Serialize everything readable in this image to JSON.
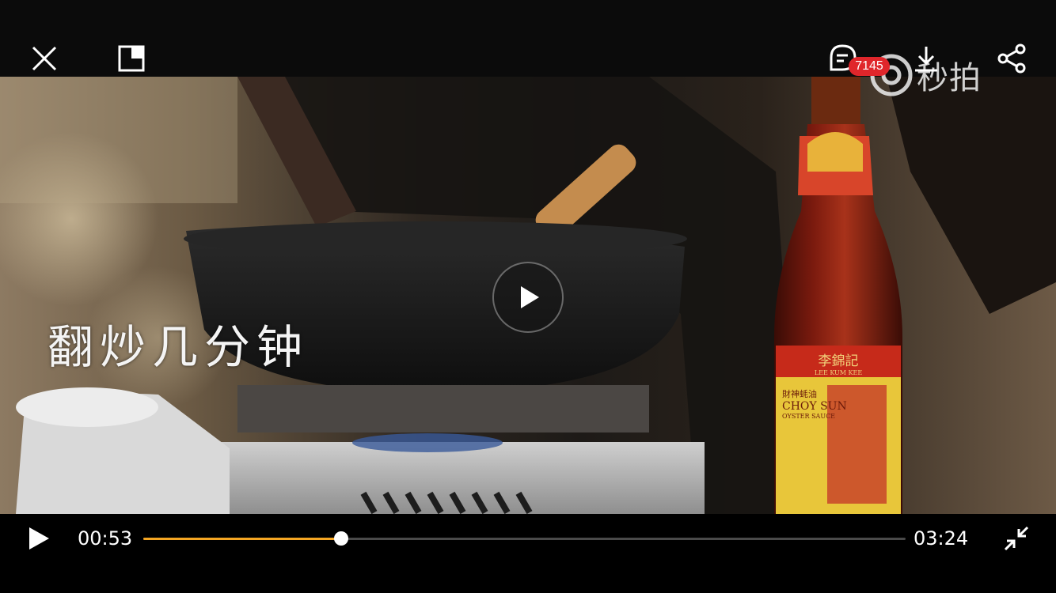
{
  "top_bar": {
    "comment_count": "7145",
    "watermark": "秒拍"
  },
  "video": {
    "subtitle": "翻炒几分钟",
    "bottle_label": {
      "brand": "李錦記",
      "english": "LEE KUM KEE",
      "product_cn": "財神蚝油",
      "product_en": "CHOY SUN",
      "product_en2": "OYSTER SAUCE"
    }
  },
  "player": {
    "current_time": "00:53",
    "total_time": "03:24",
    "progress_fraction": 0.26,
    "accent_color": "#f5a623"
  },
  "icons": {
    "close": "close-icon",
    "pip": "picture-in-picture-icon",
    "comment": "comment-icon",
    "download": "download-icon",
    "share": "share-icon",
    "play": "play-icon",
    "exit_fullscreen": "exit-fullscreen-icon"
  }
}
